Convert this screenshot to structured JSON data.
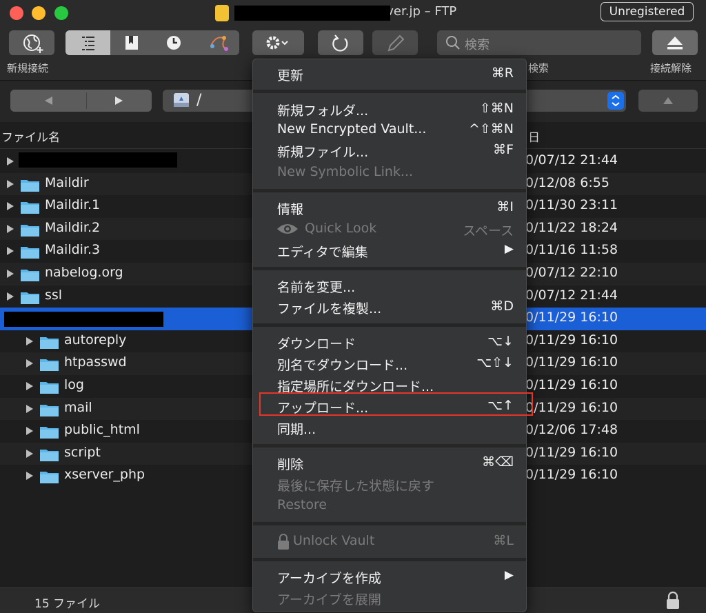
{
  "window": {
    "title": "erver.jp – FTP",
    "unregistered_label": "Unregistered"
  },
  "toolbar": {
    "new_connection_label": "新規接続",
    "search_placeholder": "検索",
    "search_label": "検索",
    "disconnect_label": "接続解除"
  },
  "path": {
    "current": "/"
  },
  "columns": {
    "name": "ファイル名",
    "date_fragment": "日"
  },
  "files": [
    {
      "name": "",
      "date": "0/07/12 21:44",
      "redacted": true
    },
    {
      "name": "Maildir",
      "date": "0/12/08 6:55"
    },
    {
      "name": "Maildir.1",
      "date": "0/11/30 23:11"
    },
    {
      "name": "Maildir.2",
      "date": "0/11/22 18:24"
    },
    {
      "name": "Maildir.3",
      "date": "0/11/16 11:58"
    },
    {
      "name": "nabelog.org",
      "date": "0/07/12 22:10"
    },
    {
      "name": "ssl",
      "date": "0/07/12 21:44"
    },
    {
      "name": "",
      "date": "0/11/29 16:10",
      "redacted": true,
      "selected": true
    },
    {
      "name": "autoreply",
      "date": "0/11/29 16:10"
    },
    {
      "name": "htpasswd",
      "date": "0/11/29 16:10"
    },
    {
      "name": "log",
      "date": "0/11/29 16:10"
    },
    {
      "name": "mail",
      "date": "0/11/29 16:10"
    },
    {
      "name": "public_html",
      "date": "0/12/06 17:48"
    },
    {
      "name": "script",
      "date": "0/11/29 16:10"
    },
    {
      "name": "xserver_php",
      "date": "0/11/29 16:10"
    }
  ],
  "status": {
    "file_count": "15 ファイル"
  },
  "menu": {
    "refresh": {
      "label": "更新",
      "shortcut": "⌘R"
    },
    "new_folder": {
      "label": "新規フォルダ...",
      "shortcut": "⇧⌘N"
    },
    "new_encrypted_vault": {
      "label": "New Encrypted Vault...",
      "shortcut": "^⇧⌘N"
    },
    "new_file": {
      "label": "新規ファイル...",
      "shortcut": "⌘F"
    },
    "new_symbolic_link": {
      "label": "New Symbolic Link..."
    },
    "info": {
      "label": "情報",
      "shortcut": "⌘I"
    },
    "quick_look": {
      "label": "Quick Look",
      "shortcut": "スペース"
    },
    "edit_with": {
      "label": "エディタで編集",
      "shortcut": "▶"
    },
    "rename": {
      "label": "名前を変更..."
    },
    "duplicate": {
      "label": "ファイルを複製...",
      "shortcut": "⌘D"
    },
    "download": {
      "label": "ダウンロード",
      "shortcut": "⌥↓"
    },
    "download_as": {
      "label": "別名でダウンロード...",
      "shortcut": "⌥⇧↓"
    },
    "download_to": {
      "label": "指定場所にダウンロード..."
    },
    "upload": {
      "label": "アップロード...",
      "shortcut": "⌥↑"
    },
    "synchronize": {
      "label": "同期..."
    },
    "delete": {
      "label": "削除",
      "shortcut": "⌘⌫"
    },
    "revert": {
      "label": "最後に保存した状態に戻す"
    },
    "restore": {
      "label": "Restore"
    },
    "unlock_vault": {
      "label": "Unlock Vault",
      "shortcut": "⌘L"
    },
    "create_archive": {
      "label": "アーカイブを作成",
      "shortcut": "▶"
    },
    "expand_archive": {
      "label": "アーカイブを展開"
    }
  },
  "colors": {
    "selection": "#1b5fd6",
    "highlight_box": "#e3352a",
    "folder": "#5bb5e8"
  }
}
